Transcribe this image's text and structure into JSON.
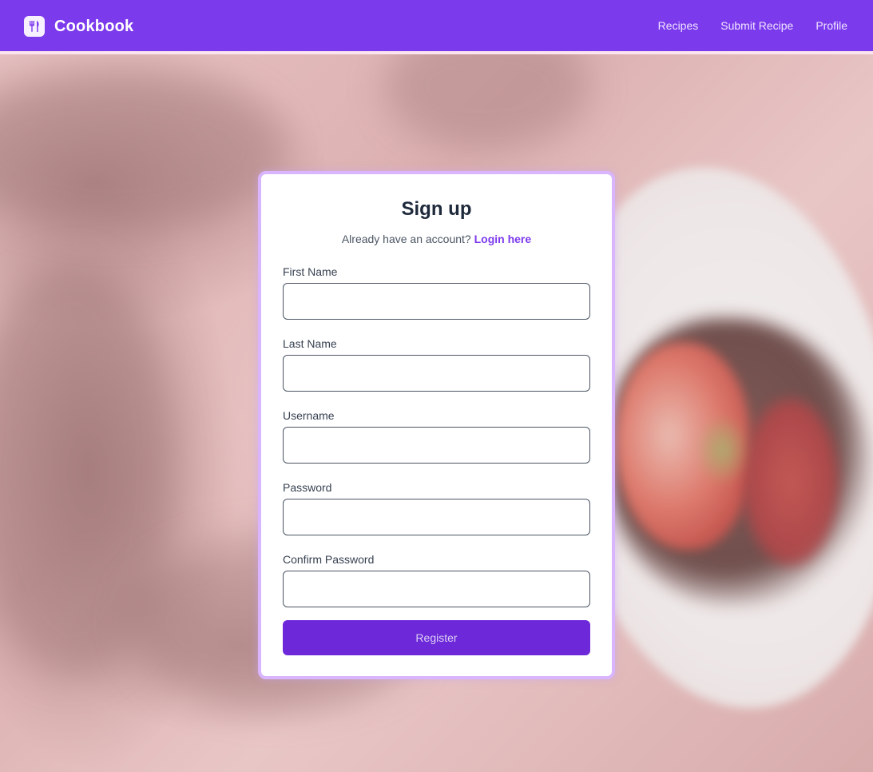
{
  "navbar": {
    "brand_name": "Cookbook",
    "brand_icon": "fork-knife-icon",
    "links": [
      "Recipes",
      "Submit Recipe",
      "Profile"
    ]
  },
  "form": {
    "title": "Sign up",
    "prompt": "Already have an account?",
    "login_link": "Login here",
    "fields": [
      {
        "label": "First Name",
        "value": ""
      },
      {
        "label": "Last Name",
        "value": ""
      },
      {
        "label": "Username",
        "value": ""
      },
      {
        "label": "Password",
        "value": ""
      },
      {
        "label": "Confirm Password",
        "value": ""
      }
    ],
    "submit_label": "Register"
  },
  "colors": {
    "navbar": "#7c3aed",
    "button": "#6d28d9",
    "card_border": "#d9b5fd",
    "link": "#7c3aed"
  }
}
